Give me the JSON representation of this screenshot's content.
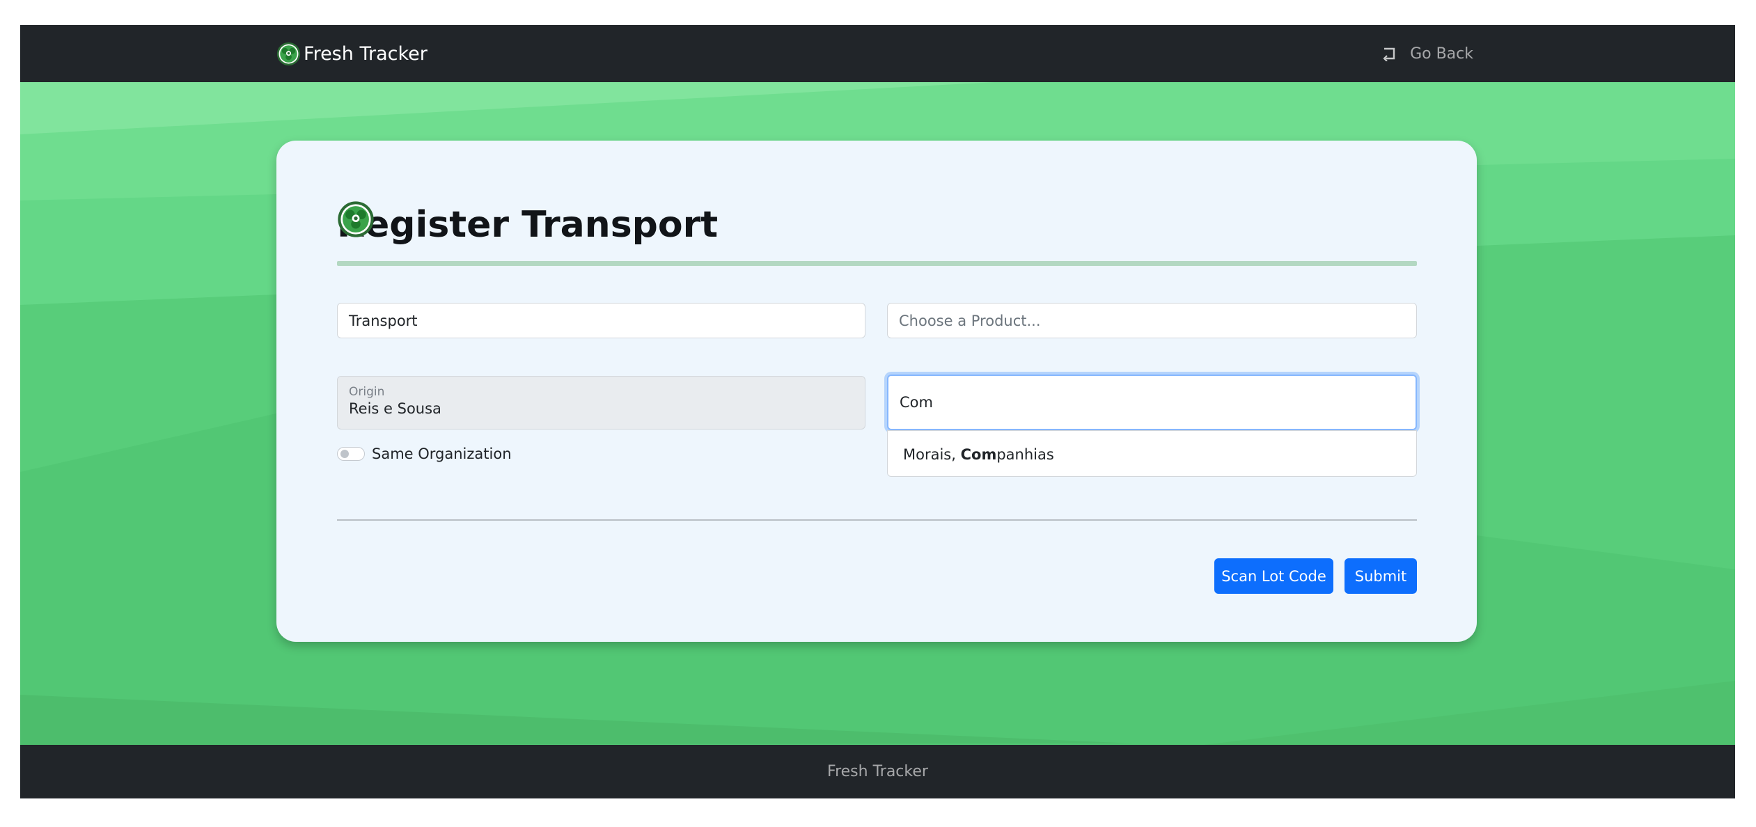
{
  "colors": {
    "navbar": "#212529",
    "background_green": "#58cd7a",
    "card": "#eef6fd",
    "primary_button": "#0d6efd",
    "title_rule": "#b3d8c2"
  },
  "navbar": {
    "brand_icon": "shamrock-badge-icon",
    "brand_text": "Fresh Tracker",
    "back_icon": "return-arrow-icon",
    "back_label": "Go Back"
  },
  "form": {
    "title_icon": "shamrock-badge-icon",
    "title": "Register Transport",
    "type_field": {
      "value": "Transport"
    },
    "product_field": {
      "value": "",
      "placeholder": "Choose a Product..."
    },
    "origin_field": {
      "label": "Origin",
      "value": "Reis e Sousa"
    },
    "destination_field": {
      "value": "Com"
    },
    "destination_suggestions": [
      {
        "prefix": "Morais, ",
        "match": "Com",
        "suffix": "panhias"
      }
    ],
    "same_org_toggle": {
      "label": "Same Organization",
      "checked": false
    },
    "scan_button": "Scan Lot Code",
    "submit_button": "Submit"
  },
  "footer": {
    "text": "Fresh Tracker"
  }
}
